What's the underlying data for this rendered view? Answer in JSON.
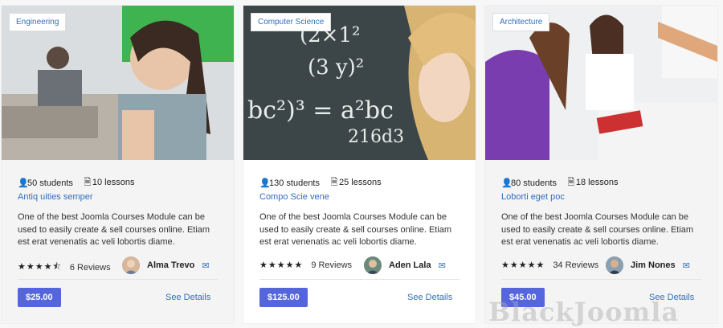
{
  "courses": [
    {
      "category": "Engineering",
      "students": "50 students",
      "lessons": "10 lessons",
      "title": "Antiq uities semper",
      "description": "One of the best Joomla Courses Module can be used to easily create & sell courses online. Etiam est erat venenatis ac veli lobortis diame.",
      "stars": "★★★★⯪",
      "rating_value": 4.5,
      "reviews": "6 Reviews",
      "author": "Alma Trevo",
      "price": "$25.00",
      "details": "See Details"
    },
    {
      "category": "Computer Science",
      "students": "130 students",
      "lessons": "25 lessons",
      "title": "Compo Scie vene",
      "description": "One of the best Joomla Courses Module can be used to easily create & sell courses online. Etiam est erat venenatis ac veli lobortis diame.",
      "stars": "★★★★★",
      "rating_value": 5,
      "reviews": "9 Reviews",
      "author": "Aden Lala",
      "price": "$125.00",
      "details": "See Details"
    },
    {
      "category": "Architecture",
      "students": "80 students",
      "lessons": "18 lessons",
      "title": "Loborti eget poc",
      "description": "One of the best Joomla Courses Module can be used to easily create & sell courses online. Etiam est erat venenatis ac veli lobortis diame.",
      "stars": "★★★★★",
      "rating_value": 5,
      "reviews": "34 Reviews",
      "author": "Jim Nones",
      "price": "$45.00",
      "details": "See Details"
    }
  ],
  "icons": {
    "students": "user-icon",
    "lessons": "file-icon",
    "mail": "envelope-icon"
  },
  "colors": {
    "link": "#2f6fbf",
    "price_bg": "#5566dd"
  },
  "watermark": "BlackJoomla"
}
